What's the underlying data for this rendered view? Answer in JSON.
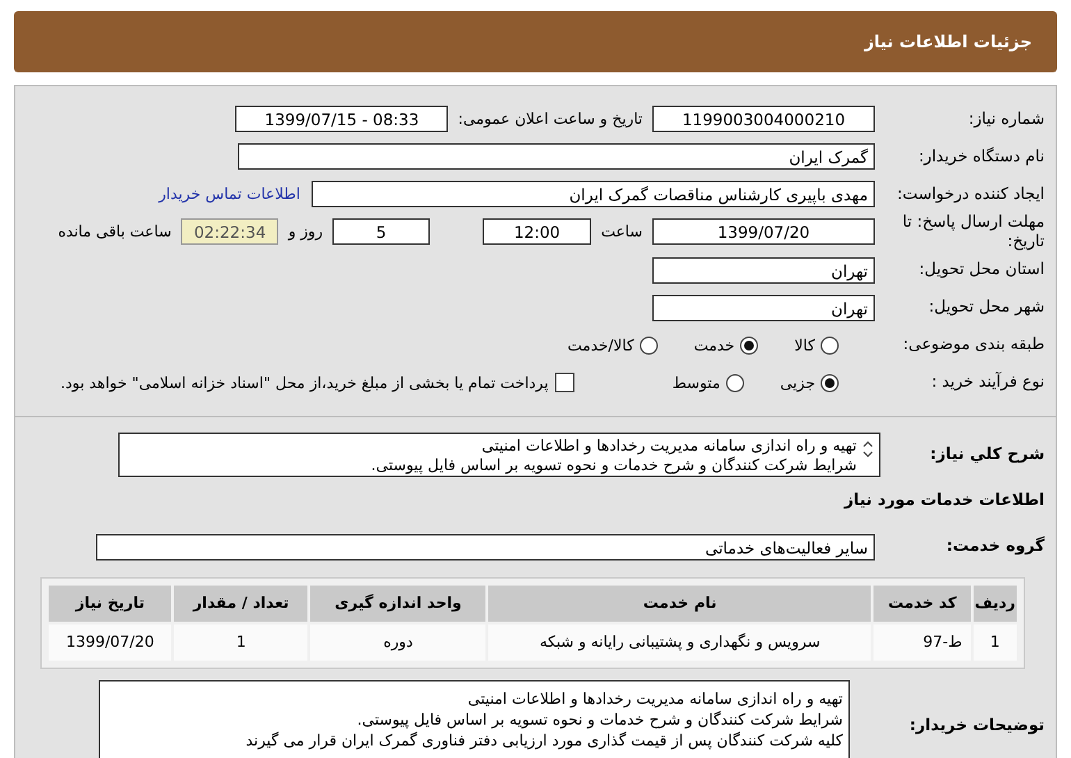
{
  "header": {
    "title": "جزئیات اطلاعات نیاز"
  },
  "need_number": {
    "label": "شماره نیاز:",
    "value": "1199003004000210"
  },
  "announce": {
    "label": "تاریخ و ساعت اعلان عمومی:",
    "value": "1399/07/15 - 08:33"
  },
  "buyer_org": {
    "label": "نام دستگاه خریدار:",
    "value": "گمرک ایران"
  },
  "requester": {
    "label": "ایجاد کننده درخواست:",
    "value": "مهدی باپیری کارشناس مناقصات گمرک ایران",
    "link": "اطلاعات تماس خریدار"
  },
  "deadline": {
    "label": "مهلت ارسال پاسخ: تا تاریخ:",
    "date": "1399/07/20",
    "time_label": "ساعت",
    "time": "12:00",
    "days": "5",
    "days_label": "روز و",
    "remaining": "02:22:34",
    "remaining_label": "ساعت باقی مانده"
  },
  "province": {
    "label": "استان محل تحویل:",
    "value": "تهران"
  },
  "city": {
    "label": "شهر محل تحویل:",
    "value": "تهران"
  },
  "category": {
    "label": "طبقه بندی موضوعی:",
    "options": [
      {
        "label": "کالا",
        "selected": false
      },
      {
        "label": "خدمت",
        "selected": true
      },
      {
        "label": "کالا/خدمت",
        "selected": false
      }
    ]
  },
  "process": {
    "label": "نوع فرآیند خرید :",
    "options": [
      {
        "label": "جزیی",
        "selected": true
      },
      {
        "label": "متوسط",
        "selected": false
      }
    ],
    "payment": {
      "checked": false,
      "text": "پرداخت تمام یا بخشی از مبلغ خرید،از محل \"اسناد خزانه اسلامی\" خواهد بود."
    }
  },
  "description": {
    "label": "شرح کلي نياز:",
    "lines": [
      "تهیه و راه اندازی سامانه مدیریت رخدادها و اطلاعات امنیتی",
      "شرایط شرکت کنندگان و شرح خدمات و نحوه تسویه بر اساس فایل پیوستی."
    ]
  },
  "services_heading": "اطلاعات خدمات مورد نیاز",
  "service_group": {
    "label": "گروه خدمت:",
    "value": "سایر فعالیت‌های خدماتی"
  },
  "table": {
    "columns": [
      "ردیف",
      "کد خدمت",
      "نام خدمت",
      "واحد اندازه گیری",
      "تعداد / مقدار",
      "تاریخ نیاز"
    ],
    "rows": [
      [
        "1",
        "ط-97",
        "سرویس و نگهداری و پشتیبانی رایانه و شبکه",
        "دوره",
        "1",
        "1399/07/20"
      ]
    ]
  },
  "buyer_notes": {
    "label": "توضیحات خریدار:",
    "lines": [
      "تهیه و راه اندازی سامانه مدیریت رخدادها و اطلاعات امنیتی",
      "شرایط شرکت کنندگان و شرح خدمات و نحوه تسویه بر اساس فایل پیوستی.",
      "کلیه شرکت کنندگان پس از قیمت گذاری مورد ارزیابی دفتر فناوری گمرک ایران قرار می گیرند"
    ]
  }
}
